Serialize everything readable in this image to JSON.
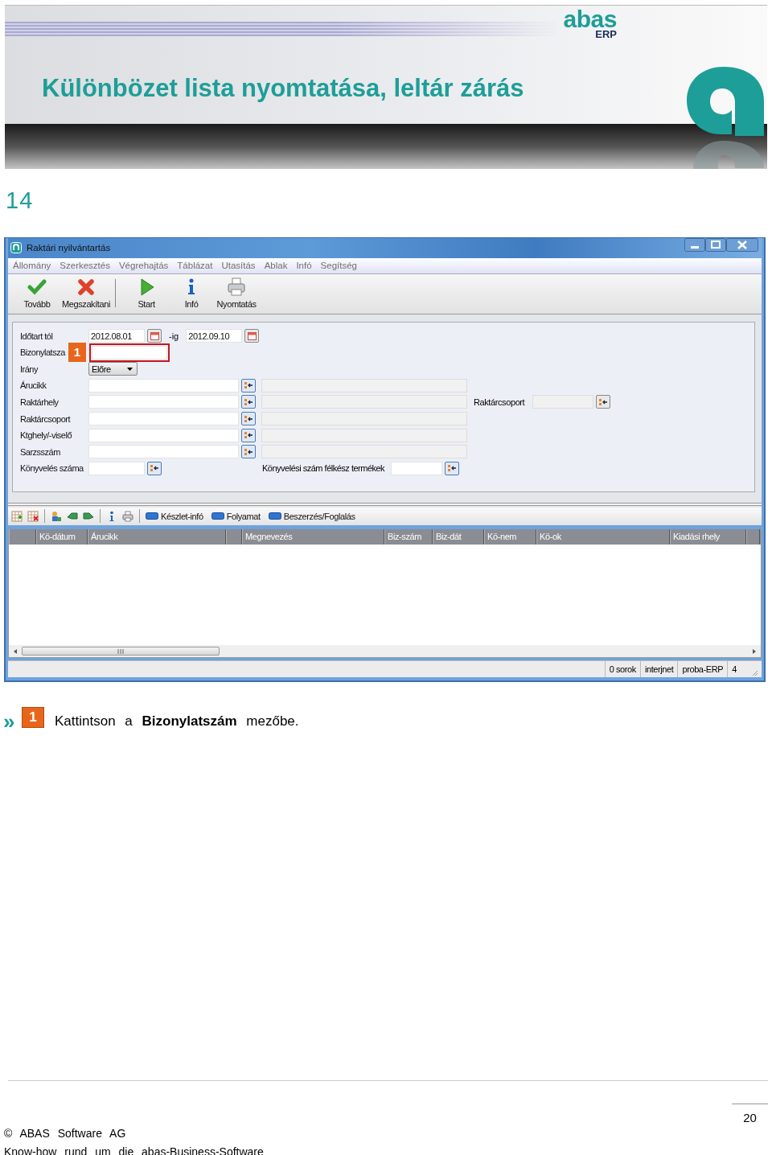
{
  "header": {
    "title": "Különbözet lista nyomtatása, leltár zárás",
    "logo_text": "abas",
    "logo_subtext": "ERP"
  },
  "page_label": "14",
  "window": {
    "title": "Raktári nyilvántartás",
    "menu": [
      "Állomány",
      "Szerkesztés",
      "Végrehajtás",
      "Táblázat",
      "Utasítás",
      "Ablak",
      "Infó",
      "Segítség"
    ],
    "toolbar_groups": [
      {
        "items": [
          {
            "kind": "continue",
            "label": "Tovább"
          },
          {
            "kind": "cancel",
            "label": "Megszakítani"
          }
        ]
      },
      {
        "items": [
          {
            "kind": "start",
            "label": "Start"
          },
          {
            "kind": "info",
            "label": "Infó"
          },
          {
            "kind": "print",
            "label": "Nyomtatás"
          }
        ]
      }
    ],
    "form": [
      {
        "kind": "date_range",
        "label": "Időtart tól",
        "from": "2012.08.01",
        "separator": "-ig",
        "to": "2012.09.10"
      },
      {
        "kind": "text",
        "label": "Bizonylatsza",
        "highlighted": true,
        "marker": "1"
      },
      {
        "kind": "dropdown",
        "label": "Irány",
        "value": "Előre"
      },
      {
        "kind": "lookup",
        "label": "Árucikk"
      },
      {
        "kind": "lookup",
        "label": "Raktárhely",
        "side": {
          "label": "Raktárcsoport"
        }
      },
      {
        "kind": "lookup",
        "label": "Raktárcsoport"
      },
      {
        "kind": "lookup",
        "label": "Ktghely/-viselő"
      },
      {
        "kind": "lookup",
        "label": "Sarzsszám"
      },
      {
        "kind": "short_lookup",
        "label": "Könyvelés száma",
        "side": {
          "label": "Könyvelési szám félkész termékek"
        }
      }
    ],
    "grid_buttons": [
      "Készlet-infó",
      "Folyamat",
      "Beszerzés/Foglalás"
    ],
    "table": {
      "columns": [
        "Kö-dátum",
        "Árucikk",
        "Megnevezés",
        "Biz-szám",
        "Biz-dát",
        "Kö-nem",
        "Kö-ok",
        "Kiadási rhely"
      ]
    },
    "status_bar": [
      "0 sorok",
      "interjnet",
      "proba-ERP",
      "4"
    ]
  },
  "instruction": {
    "bullet": "»",
    "marker": "1",
    "text": "Kattintson a **Bizonylatszám** mezőbe."
  },
  "footer": {
    "page_number": "20",
    "copyright": "© ABAS Software AG",
    "tagline": "Know-how rund um die abas-Business-Software"
  }
}
